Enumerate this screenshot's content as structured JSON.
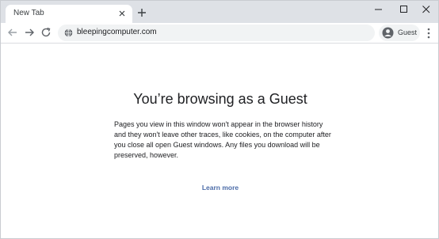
{
  "tabs": [
    {
      "title": "New Tab",
      "close_icon": "close-icon",
      "active": true
    }
  ],
  "new_tab_icon": "plus-icon",
  "window_controls": [
    "minimize-icon",
    "maximize-icon",
    "close-icon"
  ],
  "toolbar": {
    "back_icon": "arrow-left-icon",
    "forward_icon": "arrow-right-icon",
    "reload_icon": "reload-icon",
    "address": {
      "site_icon": "globe-icon",
      "url": "bleepingcomputer.com"
    },
    "profile": {
      "icon": "guest-avatar-icon",
      "label": "Guest"
    },
    "menu_icon": "three-dots-icon"
  },
  "page": {
    "heading": "You’re browsing as a Guest",
    "body": "Pages you view in this window won't appear in the browser history and they won't leave other traces, like cookies, on the computer after you close all open Guest windows. Any files you download will be preserved, however.",
    "link": "Learn more"
  },
  "colors": {
    "tabstrip": "#dee1e6",
    "link": "#4c6ca8",
    "text": "#202124"
  }
}
